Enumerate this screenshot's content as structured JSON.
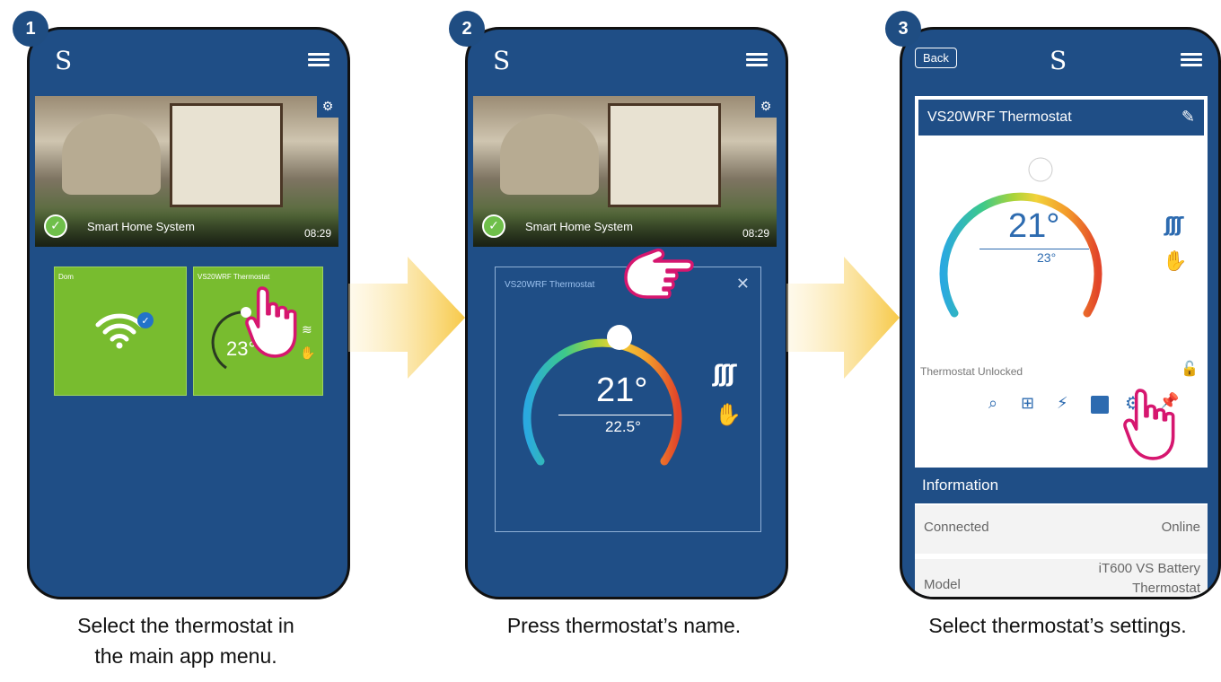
{
  "steps": [
    {
      "number": "1",
      "caption_line1": "Select the thermostat in",
      "caption_line2": "the main app menu."
    },
    {
      "number": "2",
      "caption_line1": "Press thermostat’s name."
    },
    {
      "number": "3",
      "caption_line1": "Select thermostat’s settings."
    }
  ],
  "app": {
    "logo": "S"
  },
  "screen1": {
    "banner_title": "Smart Home System",
    "banner_time": "08:29",
    "tile_dom_label": "Dom",
    "tile_thermo_label": "VS20WRF Thermostat",
    "tile_thermo_temp": "23°"
  },
  "screen2": {
    "banner_title": "Smart Home System",
    "banner_time": "08:29",
    "card_label": "VS20WRF Thermostat",
    "close": "✕",
    "current_temp": "21°",
    "set_temp": "22.5°"
  },
  "screen3": {
    "back_label": "Back",
    "device_title": "VS20WRF Thermostat",
    "current_temp": "21°",
    "set_temp": "23°",
    "lock_status": "Thermostat Unlocked",
    "info_header": "Information",
    "rows": [
      {
        "key": "Connected",
        "value": "Online"
      },
      {
        "key": "Model",
        "value_line1": "iT600 VS Battery",
        "value_line2": "Thermostat"
      }
    ]
  },
  "colors": {
    "app_blue": "#1f4e86",
    "tile_green": "#78bc2f",
    "pointer_pink": "#d6166f",
    "arrow_yellow": "#f7c948"
  }
}
